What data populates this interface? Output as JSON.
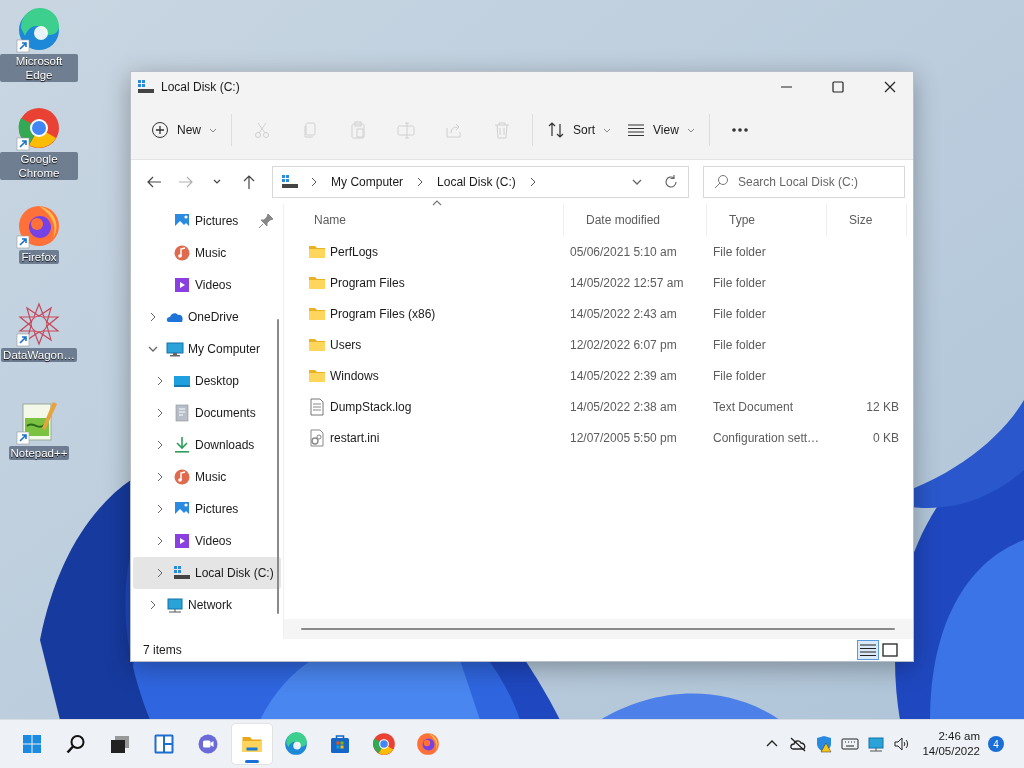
{
  "desktop_icons": [
    {
      "label": "Microsoft Edge",
      "kind": "edge"
    },
    {
      "label": "Google Chrome",
      "kind": "chrome"
    },
    {
      "label": "Firefox",
      "kind": "firefox"
    },
    {
      "label": "DataWagon…",
      "kind": "datawagon"
    },
    {
      "label": "Notepad++",
      "kind": "notepad"
    }
  ],
  "window": {
    "title": "Local Disk (C:)",
    "toolbar": [
      {
        "kind": "new",
        "label": "New",
        "disabled": false
      },
      {
        "kind": "cut",
        "disabled": true
      },
      {
        "kind": "copy",
        "disabled": true
      },
      {
        "kind": "paste",
        "disabled": true
      },
      {
        "kind": "rename",
        "disabled": true
      },
      {
        "kind": "share",
        "disabled": true
      },
      {
        "kind": "delete",
        "disabled": true
      },
      {
        "kind": "sort",
        "label": "Sort",
        "disabled": false
      },
      {
        "kind": "view",
        "label": "View",
        "disabled": false
      }
    ],
    "navigation": [
      {
        "kind": "back",
        "disabled": false
      },
      {
        "kind": "forward",
        "disabled": true
      },
      {
        "kind": "recent",
        "disabled": false
      },
      {
        "kind": "up",
        "disabled": false
      }
    ],
    "address_bar": {
      "breadcrumbs": [
        "My Computer",
        "Local Disk (C:)"
      ]
    },
    "search": {
      "placeholder": "Search Local Disk (C:)"
    },
    "sidebar": {
      "quick_access": [
        {
          "label": "Pictures",
          "kind": "pictures",
          "pinned": true,
          "selected": false
        },
        {
          "label": "Music",
          "kind": "music",
          "pinned": false,
          "selected": false
        },
        {
          "label": "Videos",
          "kind": "videos",
          "pinned": false,
          "selected": false
        }
      ],
      "items": [
        {
          "label": "OneDrive",
          "kind": "onedrive",
          "expanded": false,
          "selected": false
        },
        {
          "label": "My Computer",
          "kind": "computer",
          "expanded": true,
          "selected": false,
          "children": [
            {
              "label": "Desktop",
              "kind": "desktop",
              "expanded": false,
              "selected": false
            },
            {
              "label": "Documents",
              "kind": "documents",
              "expanded": false,
              "selected": false
            },
            {
              "label": "Downloads",
              "kind": "downloads",
              "expanded": false,
              "selected": false
            },
            {
              "label": "Music",
              "kind": "music",
              "expanded": false,
              "selected": false
            },
            {
              "label": "Pictures",
              "kind": "pictures",
              "expanded": false,
              "selected": false
            },
            {
              "label": "Videos",
              "kind": "videos",
              "expanded": false,
              "selected": false
            },
            {
              "label": "Local Disk (C:)",
              "kind": "drive",
              "expanded": false,
              "selected": true
            }
          ]
        },
        {
          "label": "Network",
          "kind": "network",
          "expanded": false,
          "selected": false
        }
      ]
    },
    "table": {
      "columns": [
        {
          "label": "Name",
          "sorted": true
        },
        {
          "label": "Date modified",
          "sorted": false
        },
        {
          "label": "Type",
          "sorted": false
        },
        {
          "label": "Size",
          "sorted": false
        }
      ],
      "rows": [
        {
          "kind": "folder",
          "name": "PerfLogs",
          "date": "05/06/2021 5:10 am",
          "type": "File folder"
        },
        {
          "kind": "folder",
          "name": "Program Files",
          "date": "14/05/2022 12:57 am",
          "type": "File folder"
        },
        {
          "kind": "folder",
          "name": "Program Files (x86)",
          "date": "14/05/2022 2:43 am",
          "type": "File folder"
        },
        {
          "kind": "folder",
          "name": "Users",
          "date": "12/02/2022 6:07 pm",
          "type": "File folder"
        },
        {
          "kind": "folder",
          "name": "Windows",
          "date": "14/05/2022 2:39 am",
          "type": "File folder"
        },
        {
          "kind": "text",
          "name": "DumpStack.log",
          "date": "14/05/2022 2:38 am",
          "type": "Text Document",
          "size": "12 KB"
        },
        {
          "kind": "config",
          "name": "restart.ini",
          "date": "12/07/2005 5:50 pm",
          "type": "Configuration sett…",
          "size": "0 KB"
        }
      ]
    },
    "status_bar": {
      "item_count": "7 items",
      "views": [
        {
          "kind": "details",
          "selected": true
        },
        {
          "kind": "tiles",
          "selected": false
        }
      ]
    }
  },
  "taskbar": {
    "apps": [
      {
        "kind": "start",
        "active": false
      },
      {
        "kind": "search",
        "active": false
      },
      {
        "kind": "taskview",
        "active": false
      },
      {
        "kind": "widgets",
        "active": false
      },
      {
        "kind": "chat",
        "active": false
      },
      {
        "kind": "explorer",
        "active": true
      },
      {
        "kind": "edge",
        "active": false
      },
      {
        "kind": "store",
        "active": false
      },
      {
        "kind": "chrome",
        "active": false
      },
      {
        "kind": "firefox",
        "active": false
      }
    ],
    "tray": [
      {
        "kind": "chevron"
      },
      {
        "kind": "cloud-off"
      },
      {
        "kind": "security"
      },
      {
        "kind": "keyboard"
      },
      {
        "kind": "network"
      },
      {
        "kind": "volume"
      }
    ],
    "time": "2:46 am",
    "date": "14/05/2022",
    "notification_count": "4"
  }
}
